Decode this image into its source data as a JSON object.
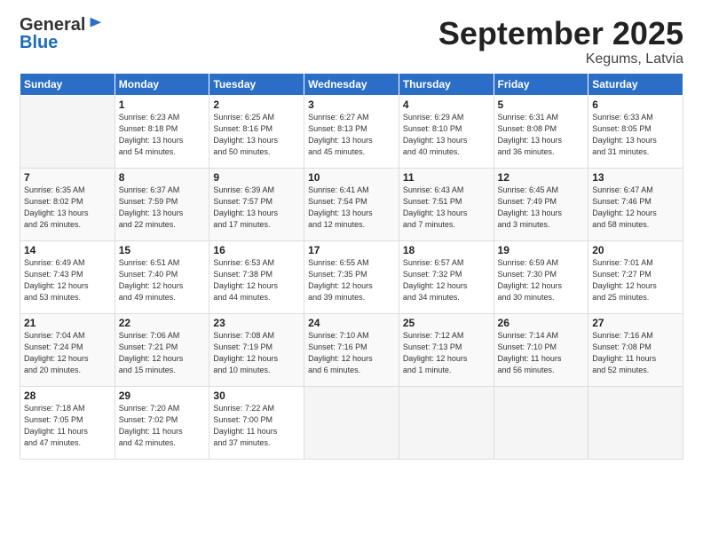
{
  "logo": {
    "general": "General",
    "blue": "Blue"
  },
  "title": "September 2025",
  "location": "Kegums, Latvia",
  "headers": [
    "Sunday",
    "Monday",
    "Tuesday",
    "Wednesday",
    "Thursday",
    "Friday",
    "Saturday"
  ],
  "weeks": [
    [
      {
        "day": "",
        "info": ""
      },
      {
        "day": "1",
        "info": "Sunrise: 6:23 AM\nSunset: 8:18 PM\nDaylight: 13 hours\nand 54 minutes."
      },
      {
        "day": "2",
        "info": "Sunrise: 6:25 AM\nSunset: 8:16 PM\nDaylight: 13 hours\nand 50 minutes."
      },
      {
        "day": "3",
        "info": "Sunrise: 6:27 AM\nSunset: 8:13 PM\nDaylight: 13 hours\nand 45 minutes."
      },
      {
        "day": "4",
        "info": "Sunrise: 6:29 AM\nSunset: 8:10 PM\nDaylight: 13 hours\nand 40 minutes."
      },
      {
        "day": "5",
        "info": "Sunrise: 6:31 AM\nSunset: 8:08 PM\nDaylight: 13 hours\nand 36 minutes."
      },
      {
        "day": "6",
        "info": "Sunrise: 6:33 AM\nSunset: 8:05 PM\nDaylight: 13 hours\nand 31 minutes."
      }
    ],
    [
      {
        "day": "7",
        "info": "Sunrise: 6:35 AM\nSunset: 8:02 PM\nDaylight: 13 hours\nand 26 minutes."
      },
      {
        "day": "8",
        "info": "Sunrise: 6:37 AM\nSunset: 7:59 PM\nDaylight: 13 hours\nand 22 minutes."
      },
      {
        "day": "9",
        "info": "Sunrise: 6:39 AM\nSunset: 7:57 PM\nDaylight: 13 hours\nand 17 minutes."
      },
      {
        "day": "10",
        "info": "Sunrise: 6:41 AM\nSunset: 7:54 PM\nDaylight: 13 hours\nand 12 minutes."
      },
      {
        "day": "11",
        "info": "Sunrise: 6:43 AM\nSunset: 7:51 PM\nDaylight: 13 hours\nand 7 minutes."
      },
      {
        "day": "12",
        "info": "Sunrise: 6:45 AM\nSunset: 7:49 PM\nDaylight: 13 hours\nand 3 minutes."
      },
      {
        "day": "13",
        "info": "Sunrise: 6:47 AM\nSunset: 7:46 PM\nDaylight: 12 hours\nand 58 minutes."
      }
    ],
    [
      {
        "day": "14",
        "info": "Sunrise: 6:49 AM\nSunset: 7:43 PM\nDaylight: 12 hours\nand 53 minutes."
      },
      {
        "day": "15",
        "info": "Sunrise: 6:51 AM\nSunset: 7:40 PM\nDaylight: 12 hours\nand 49 minutes."
      },
      {
        "day": "16",
        "info": "Sunrise: 6:53 AM\nSunset: 7:38 PM\nDaylight: 12 hours\nand 44 minutes."
      },
      {
        "day": "17",
        "info": "Sunrise: 6:55 AM\nSunset: 7:35 PM\nDaylight: 12 hours\nand 39 minutes."
      },
      {
        "day": "18",
        "info": "Sunrise: 6:57 AM\nSunset: 7:32 PM\nDaylight: 12 hours\nand 34 minutes."
      },
      {
        "day": "19",
        "info": "Sunrise: 6:59 AM\nSunset: 7:30 PM\nDaylight: 12 hours\nand 30 minutes."
      },
      {
        "day": "20",
        "info": "Sunrise: 7:01 AM\nSunset: 7:27 PM\nDaylight: 12 hours\nand 25 minutes."
      }
    ],
    [
      {
        "day": "21",
        "info": "Sunrise: 7:04 AM\nSunset: 7:24 PM\nDaylight: 12 hours\nand 20 minutes."
      },
      {
        "day": "22",
        "info": "Sunrise: 7:06 AM\nSunset: 7:21 PM\nDaylight: 12 hours\nand 15 minutes."
      },
      {
        "day": "23",
        "info": "Sunrise: 7:08 AM\nSunset: 7:19 PM\nDaylight: 12 hours\nand 10 minutes."
      },
      {
        "day": "24",
        "info": "Sunrise: 7:10 AM\nSunset: 7:16 PM\nDaylight: 12 hours\nand 6 minutes."
      },
      {
        "day": "25",
        "info": "Sunrise: 7:12 AM\nSunset: 7:13 PM\nDaylight: 12 hours\nand 1 minute."
      },
      {
        "day": "26",
        "info": "Sunrise: 7:14 AM\nSunset: 7:10 PM\nDaylight: 11 hours\nand 56 minutes."
      },
      {
        "day": "27",
        "info": "Sunrise: 7:16 AM\nSunset: 7:08 PM\nDaylight: 11 hours\nand 52 minutes."
      }
    ],
    [
      {
        "day": "28",
        "info": "Sunrise: 7:18 AM\nSunset: 7:05 PM\nDaylight: 11 hours\nand 47 minutes."
      },
      {
        "day": "29",
        "info": "Sunrise: 7:20 AM\nSunset: 7:02 PM\nDaylight: 11 hours\nand 42 minutes."
      },
      {
        "day": "30",
        "info": "Sunrise: 7:22 AM\nSunset: 7:00 PM\nDaylight: 11 hours\nand 37 minutes."
      },
      {
        "day": "",
        "info": ""
      },
      {
        "day": "",
        "info": ""
      },
      {
        "day": "",
        "info": ""
      },
      {
        "day": "",
        "info": ""
      }
    ]
  ]
}
